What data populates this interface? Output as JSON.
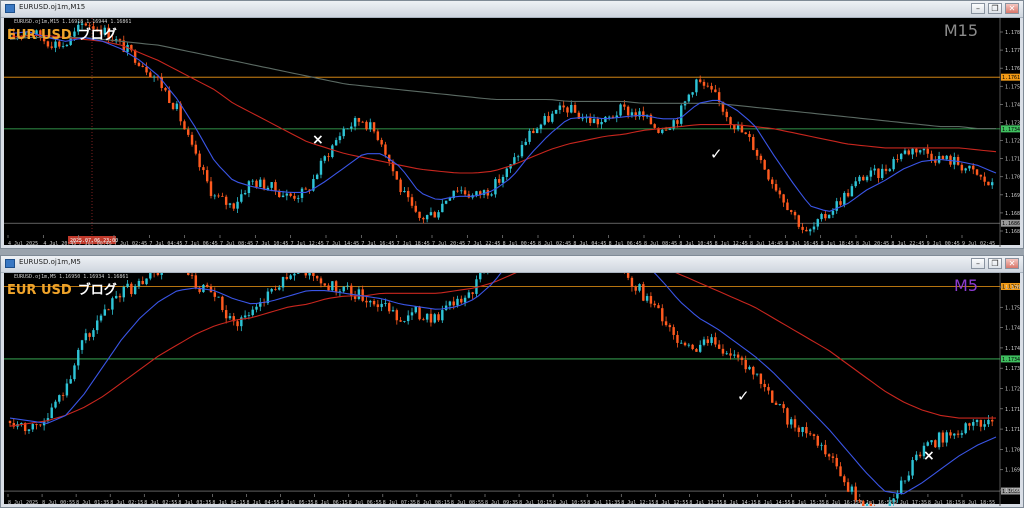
{
  "colors": {
    "bull": "#2ec4d6",
    "bear": "#ff5a1f",
    "ma_fast": "#3a55e6",
    "ma_slow": "#c8261e",
    "ma_long": "#5b6a63",
    "hline_orange": "#f29a16",
    "hline_green": "#3fbf5f",
    "sym": "#f0a42a",
    "tf_m15": "#8c8c8c",
    "tf_m5": "#8c3bd0"
  },
  "windows": [
    {
      "id": "m15",
      "title": "EURUSD.oj1m,M15",
      "info": "EURUSD.oj1m,M15  1.16918 1.16944 1.16861",
      "symbol": "EUR USD",
      "blog": "ブログ",
      "timeframe": "M15",
      "tf_color": "#8c8c8c",
      "price_labels": [
        "1.17842",
        "1.17745",
        "1.17655",
        "1.17560",
        "1.17465",
        "1.17370",
        "1.17275",
        "1.17180",
        "1.17085",
        "1.16990",
        "1.16895",
        "1.16800"
      ],
      "hline_labels": {
        "orange": "1.17615",
        "green": "1.17348",
        "bottom": "1.16861"
      },
      "time_labels": [
        "4 Jul 2025",
        "4 Jul 20:45",
        "7 Jul 00:45",
        "7 Jul 02:45",
        "7 Jul 04:45",
        "7 Jul 06:45",
        "7 Jul 08:45",
        "7 Jul 10:45",
        "7 Jul 12:45",
        "7 Jul 14:45",
        "7 Jul 16:45",
        "7 Jul 18:45",
        "7 Jul 20:45",
        "7 Jul 22:45",
        "8 Jul 00:45",
        "8 Jul 02:45",
        "8 Jul 04:45",
        "8 Jul 06:45",
        "8 Jul 08:45",
        "8 Jul 10:45",
        "8 Jul 12:45",
        "8 Jul 14:45",
        "8 Jul 16:45",
        "8 Jul 18:45",
        "8 Jul 20:45",
        "8 Jul 22:45",
        "9 Jul 00:45",
        "9 Jul 02:45"
      ],
      "period_sep_label": "2025.07.06 23:00",
      "cross_mark": "×",
      "check_mark": "✓"
    },
    {
      "id": "m5",
      "title": "EURUSD.oj1m,M5",
      "info": "EURUSD.oj1m,M5  1.16950 1.16934 1.16861",
      "symbol": "EUR USD",
      "blog": "ブログ",
      "timeframe": "M5",
      "tf_color": "#8c3bd0",
      "price_labels": [
        "1.17630",
        "1.17555",
        "1.17480",
        "1.17405",
        "1.17330",
        "1.17255",
        "1.17180",
        "1.17105",
        "1.17030",
        "1.16955",
        "1.16880"
      ],
      "hline_labels": {
        "orange": "1.17615",
        "green": "1.17348",
        "bottom": "1.16861"
      },
      "time_labels": [
        "8 Jul 2025",
        "8 Jul 00:55",
        "8 Jul 01:35",
        "8 Jul 02:15",
        "8 Jul 02:55",
        "8 Jul 03:35",
        "8 Jul 04:15",
        "8 Jul 04:55",
        "8 Jul 05:35",
        "8 Jul 06:15",
        "8 Jul 06:55",
        "8 Jul 07:35",
        "8 Jul 08:15",
        "8 Jul 08:55",
        "8 Jul 09:35",
        "8 Jul 10:15",
        "8 Jul 10:55",
        "8 Jul 11:35",
        "8 Jul 12:15",
        "8 Jul 12:55",
        "8 Jul 13:35",
        "8 Jul 14:15",
        "8 Jul 14:55",
        "8 Jul 15:35",
        "8 Jul 16:15",
        "8 Jul 16:55",
        "8 Jul 17:35",
        "8 Jul 18:15",
        "8 Jul 18:55"
      ],
      "cross_mark": "×",
      "check_mark": "✓"
    }
  ],
  "chart_data": [
    {
      "type": "candlestick",
      "timeframe": "M15",
      "ylim": [
        1.168,
        1.179
      ],
      "hlines": [
        1.17615,
        1.17348,
        1.16861
      ],
      "close_path": [
        1.1782,
        1.1786,
        1.178,
        1.1778,
        1.179,
        1.1786,
        1.1778,
        1.177,
        1.176,
        1.1745,
        1.172,
        1.17,
        1.1695,
        1.1708,
        1.1705,
        1.17,
        1.1702,
        1.172,
        1.1735,
        1.174,
        1.173,
        1.1705,
        1.1688,
        1.1692,
        1.1705,
        1.17,
        1.1704,
        1.1715,
        1.1732,
        1.174,
        1.1746,
        1.174,
        1.1738,
        1.1745,
        1.1742,
        1.1735,
        1.174,
        1.176,
        1.1752,
        1.1738,
        1.1728,
        1.171,
        1.1695,
        1.168,
        1.169,
        1.17,
        1.171,
        1.1712,
        1.1722,
        1.1725,
        1.172,
        1.1718,
        1.1712,
        1.1705
      ],
      "ma_fast_path": [
        1.1784,
        1.1785,
        1.1782,
        1.178,
        1.1782,
        1.178,
        1.1776,
        1.177,
        1.1762,
        1.175,
        1.1735,
        1.1718,
        1.1708,
        1.1705,
        1.1703,
        1.1702,
        1.1702,
        1.1708,
        1.1715,
        1.1722,
        1.1722,
        1.1715,
        1.1702,
        1.1698,
        1.17,
        1.17,
        1.1703,
        1.171,
        1.1722,
        1.1732,
        1.174,
        1.1741,
        1.174,
        1.1741,
        1.1742,
        1.174,
        1.174,
        1.1748,
        1.175,
        1.1745,
        1.1737,
        1.1722,
        1.1708,
        1.1695,
        1.1692,
        1.1696,
        1.1703,
        1.1708,
        1.1714,
        1.1718,
        1.1719,
        1.1718,
        1.1716,
        1.1712
      ],
      "ma_slow_path": [
        1.1782,
        1.1783,
        1.1783,
        1.1782,
        1.1781,
        1.178,
        1.1778,
        1.1774,
        1.177,
        1.1765,
        1.176,
        1.1755,
        1.1748,
        1.1743,
        1.1738,
        1.1733,
        1.1728,
        1.1725,
        1.1722,
        1.172,
        1.1718,
        1.1716,
        1.1714,
        1.1713,
        1.1712,
        1.1712,
        1.1713,
        1.1716,
        1.172,
        1.1724,
        1.1727,
        1.1729,
        1.1731,
        1.1732,
        1.1734,
        1.1735,
        1.1736,
        1.1737,
        1.1737,
        1.1737,
        1.1736,
        1.1735,
        1.1733,
        1.1731,
        1.1729,
        1.1727,
        1.1726,
        1.1725,
        1.1725,
        1.1725,
        1.1725,
        1.1725,
        1.1724,
        1.1723
      ],
      "ma_long_path": [
        1.1781,
        1.1782,
        1.1782,
        1.1782,
        1.1782,
        1.1781,
        1.178,
        1.1779,
        1.1778,
        1.1776,
        1.1774,
        1.1772,
        1.177,
        1.1768,
        1.1766,
        1.1764,
        1.1762,
        1.176,
        1.1758,
        1.1757,
        1.1756,
        1.1755,
        1.1754,
        1.1753,
        1.1752,
        1.1751,
        1.175,
        1.175,
        1.175,
        1.175,
        1.1749,
        1.1749,
        1.1749,
        1.1749,
        1.1748,
        1.1748,
        1.1748,
        1.1748,
        1.1748,
        1.1747,
        1.1746,
        1.1745,
        1.1744,
        1.1743,
        1.1742,
        1.1741,
        1.174,
        1.1739,
        1.1738,
        1.1737,
        1.1736,
        1.1736,
        1.1735,
        1.1735
      ]
    },
    {
      "type": "candlestick",
      "timeframe": "M5",
      "ylim": [
        1.1685,
        1.1765
      ],
      "hlines": [
        1.17615,
        1.17348,
        1.16861
      ],
      "close_path": [
        1.1712,
        1.171,
        1.1712,
        1.1725,
        1.1742,
        1.175,
        1.176,
        1.1762,
        1.1768,
        1.177,
        1.1762,
        1.1758,
        1.1748,
        1.1752,
        1.176,
        1.1765,
        1.1768,
        1.1762,
        1.176,
        1.1758,
        1.1755,
        1.175,
        1.1752,
        1.175,
        1.1755,
        1.176,
        1.1775,
        1.1785,
        1.1795,
        1.18,
        1.1792,
        1.1782,
        1.1775,
        1.1768,
        1.176,
        1.1752,
        1.1742,
        1.1738,
        1.1742,
        1.1735,
        1.173,
        1.1722,
        1.1712,
        1.1708,
        1.17,
        1.169,
        1.168,
        1.1678,
        1.1688,
        1.17,
        1.1705,
        1.1708,
        1.171,
        1.1712
      ],
      "ma_fast_path": [
        1.1713,
        1.1712,
        1.1711,
        1.1714,
        1.1722,
        1.1732,
        1.1742,
        1.175,
        1.1756,
        1.176,
        1.1761,
        1.176,
        1.1757,
        1.1755,
        1.1756,
        1.1758,
        1.176,
        1.176,
        1.1759,
        1.1758,
        1.1757,
        1.1755,
        1.1754,
        1.1753,
        1.1754,
        1.1757,
        1.1763,
        1.1772,
        1.1781,
        1.1788,
        1.179,
        1.1788,
        1.1784,
        1.1778,
        1.1771,
        1.1764,
        1.1756,
        1.175,
        1.1746,
        1.1741,
        1.1736,
        1.173,
        1.1723,
        1.1716,
        1.1709,
        1.1701,
        1.1693,
        1.1686,
        1.1685,
        1.1689,
        1.1694,
        1.1699,
        1.1703,
        1.1706
      ],
      "ma_slow_path": [
        1.171,
        1.1711,
        1.1712,
        1.1714,
        1.1717,
        1.1721,
        1.1726,
        1.1731,
        1.1736,
        1.174,
        1.1744,
        1.1747,
        1.1749,
        1.175,
        1.1752,
        1.1754,
        1.1755,
        1.1757,
        1.1758,
        1.1758,
        1.1759,
        1.1759,
        1.1759,
        1.1759,
        1.176,
        1.1761,
        1.1763,
        1.1766,
        1.1769,
        1.1772,
        1.1774,
        1.1775,
        1.1775,
        1.1774,
        1.1772,
        1.1769,
        1.1766,
        1.1763,
        1.176,
        1.1757,
        1.1754,
        1.175,
        1.1746,
        1.1742,
        1.1738,
        1.1733,
        1.1728,
        1.1723,
        1.1719,
        1.1716,
        1.1714,
        1.1713,
        1.1713,
        1.1713
      ]
    }
  ]
}
